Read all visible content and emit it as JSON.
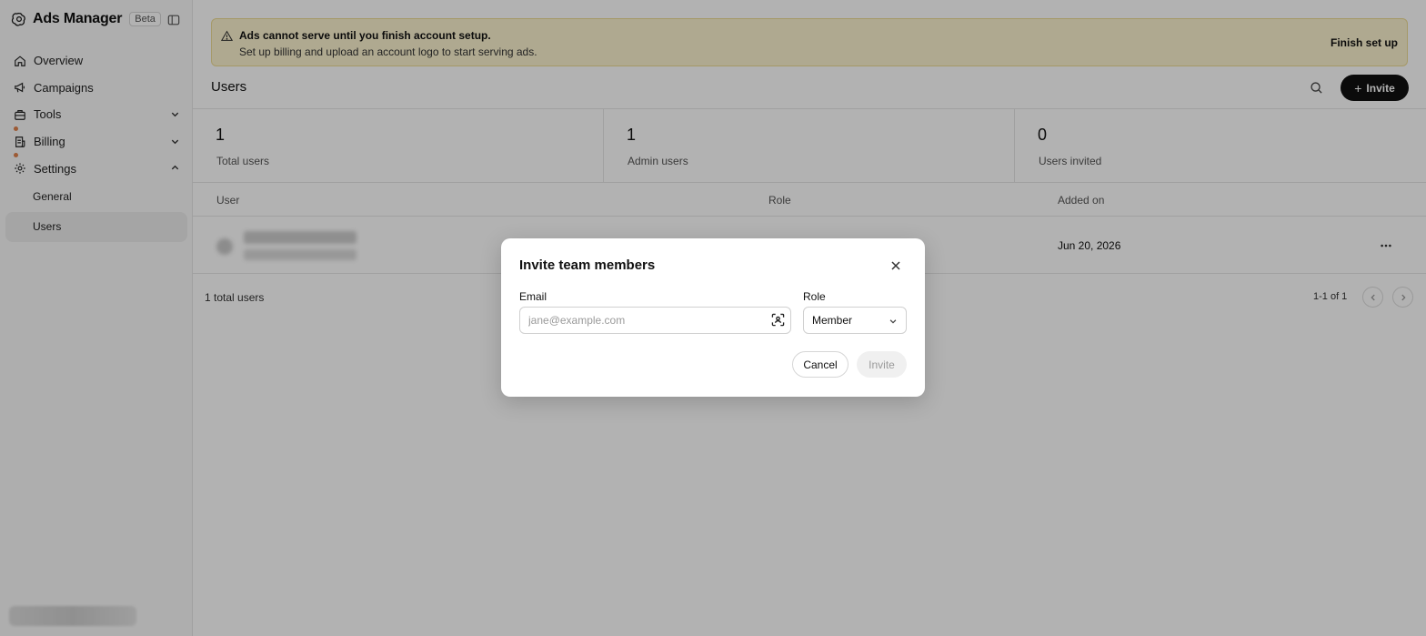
{
  "sidebar": {
    "app_name": "Ads Manager",
    "badge": "Beta",
    "nav": [
      {
        "label": "Overview"
      },
      {
        "label": "Campaigns"
      },
      {
        "label": "Tools"
      },
      {
        "label": "Billing"
      },
      {
        "label": "Settings"
      }
    ],
    "settings_sub": [
      {
        "label": "General"
      },
      {
        "label": "Users"
      }
    ]
  },
  "banner": {
    "title": "Ads cannot serve until you finish account setup.",
    "text": "Set up billing and upload an account logo to start serving ads.",
    "action": "Finish set up"
  },
  "page": {
    "title": "Users",
    "invite_label": "Invite"
  },
  "stats": [
    {
      "value": "1",
      "label": "Total users"
    },
    {
      "value": "1",
      "label": "Admin users"
    },
    {
      "value": "0",
      "label": "Users invited"
    }
  ],
  "table": {
    "columns": [
      "User",
      "Role",
      "Added on"
    ],
    "rows": [
      {
        "added_on": "Jun 20, 2026"
      }
    ],
    "footer_total": "1 total users",
    "pagination": "1-1 of 1"
  },
  "modal": {
    "title": "Invite team members",
    "email_label": "Email",
    "email_placeholder": "jane@example.com",
    "email_value": "",
    "role_label": "Role",
    "role_value": "Member",
    "cancel_label": "Cancel",
    "submit_label": "Invite"
  },
  "colors": {
    "banner_bg": "#fbf3cf",
    "banner_border": "#eddc94",
    "primary_button": "#111111",
    "notification_dot": "#e0824c"
  }
}
